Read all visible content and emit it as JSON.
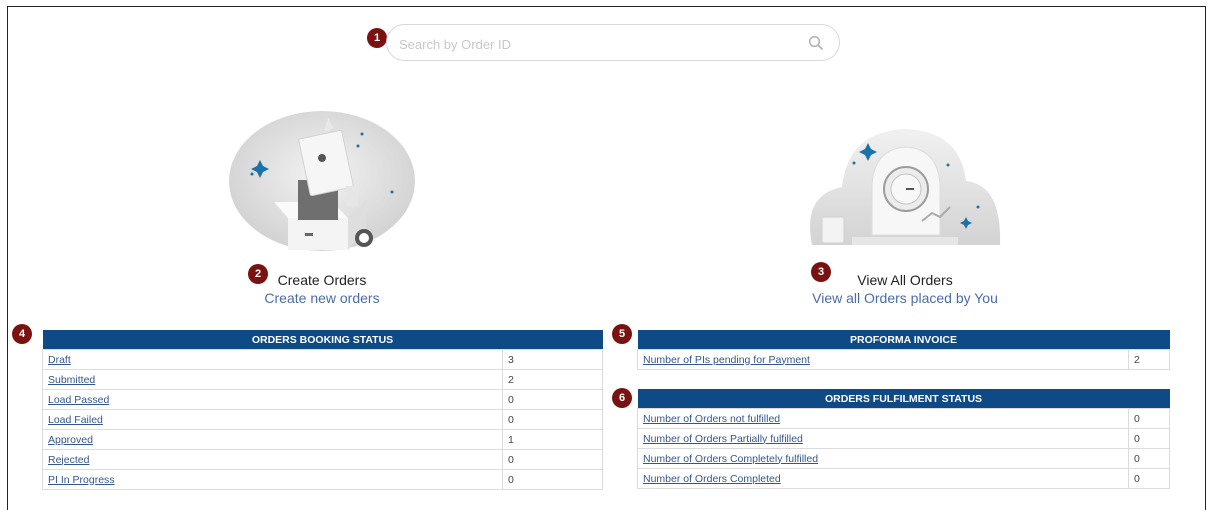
{
  "search": {
    "placeholder": "Search by Order ID",
    "icon": "search-icon"
  },
  "markers": [
    "1",
    "2",
    "3",
    "4",
    "5",
    "6"
  ],
  "cards": {
    "create": {
      "title": "Create Orders",
      "link": "Create new orders",
      "icon": "shopping-bag-box-illustration"
    },
    "view": {
      "title": "View All Orders",
      "link": "View all Orders placed by You",
      "icon": "clock-dome-illustration"
    }
  },
  "booking": {
    "header": "ORDERS BOOKING STATUS",
    "rows": [
      {
        "label": "Draft",
        "value": "3"
      },
      {
        "label": "Submitted",
        "value": "2"
      },
      {
        "label": "Load Passed",
        "value": "0"
      },
      {
        "label": "Load Failed",
        "value": "0"
      },
      {
        "label": "Approved",
        "value": "1"
      },
      {
        "label": "Rejected",
        "value": "0"
      },
      {
        "label": "PI In Progress",
        "value": "0"
      }
    ]
  },
  "proforma": {
    "header": "PROFORMA INVOICE",
    "rows": [
      {
        "label": "Number of PIs pending for Payment",
        "value": "2"
      }
    ]
  },
  "fulfilment": {
    "header": "ORDERS FULFILMENT STATUS",
    "rows": [
      {
        "label": "Number of Orders not fulfilled",
        "value": "0"
      },
      {
        "label": "Number of Orders Partially fulfilled",
        "value": "0"
      },
      {
        "label": "Number of Orders Completely fulfilled",
        "value": "0"
      },
      {
        "label": "Number of Orders Completed",
        "value": "0"
      }
    ]
  },
  "colors": {
    "header_bg": "#0d4a86",
    "marker": "#7a1212",
    "link": "#4b6ca8"
  }
}
